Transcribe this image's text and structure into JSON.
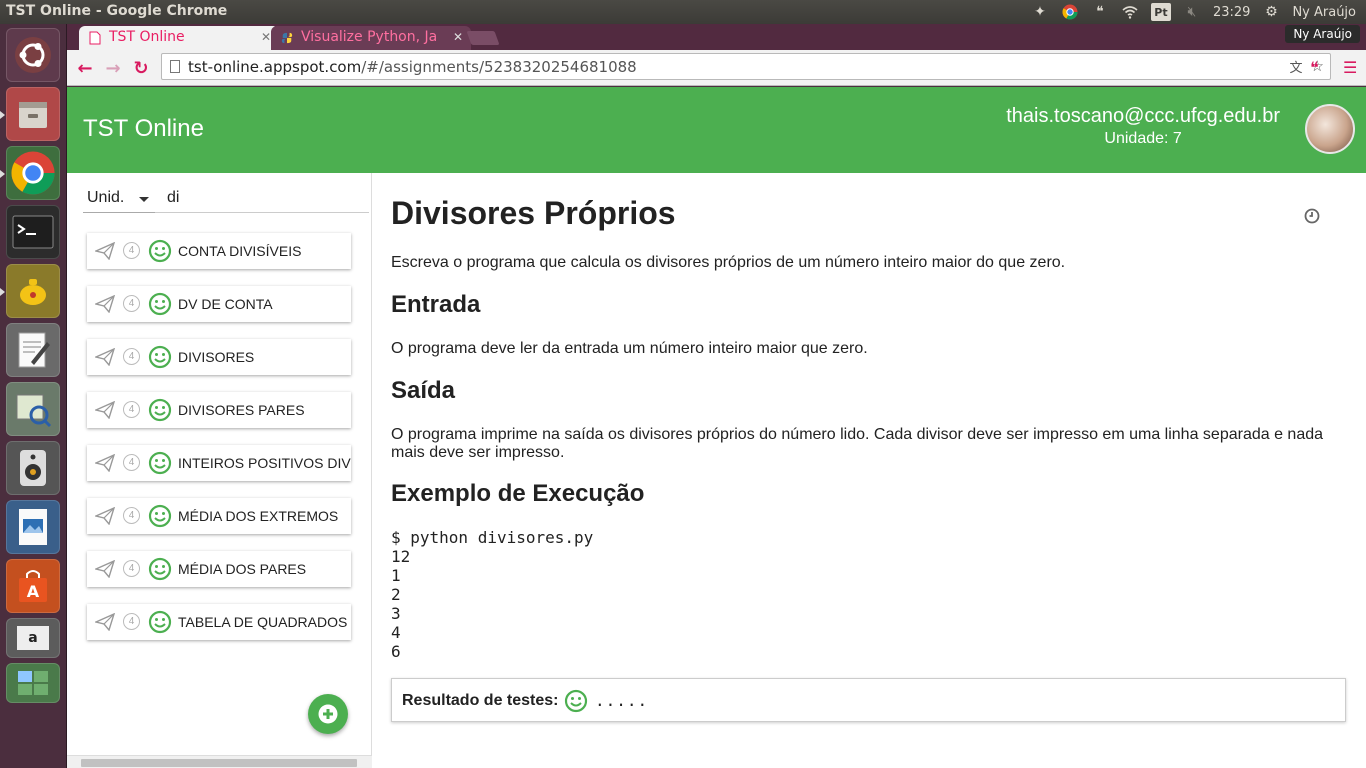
{
  "os": {
    "window_title": "TST Online - Google Chrome",
    "clock": "23:29",
    "user": "Ny Araújo",
    "tray_pt": "Pt"
  },
  "browser": {
    "tabs": [
      {
        "label": "TST Online",
        "active": true
      },
      {
        "label": "Visualize Python, Ja",
        "active": false
      }
    ],
    "profile": "Ny Araújo",
    "url_host": "tst-online.appspot.com",
    "url_path": "/#/assignments/5238320254681088"
  },
  "app": {
    "brand": "TST Online",
    "user_email": "thais.toscano@ccc.ufcg.edu.br",
    "user_unit": "Unidade: 7",
    "accent_color": "#4caf50"
  },
  "sidebar": {
    "unit_select": "Unid.",
    "filter_value": "di",
    "items": [
      {
        "title": "CONTA DIVISÍVEIS",
        "badge": "4"
      },
      {
        "title": "DV DE CONTA",
        "badge": "4"
      },
      {
        "title": "DIVISORES",
        "badge": "4"
      },
      {
        "title": "DIVISORES PARES",
        "badge": "4"
      },
      {
        "title": "INTEIROS POSITIVOS DIV",
        "badge": "4"
      },
      {
        "title": "MÉDIA DOS EXTREMOS",
        "badge": "4"
      },
      {
        "title": "MÉDIA DOS PARES",
        "badge": "4"
      },
      {
        "title": "TABELA DE QUADRADOS",
        "badge": "4"
      }
    ]
  },
  "assignment": {
    "title": "Divisores Próprios",
    "description": "Escreva o programa que calcula os divisores próprios de um número inteiro maior do que zero.",
    "input_heading": "Entrada",
    "input_text": "O programa deve ler da entrada um número inteiro maior que zero.",
    "output_heading": "Saída",
    "output_text": "O programa imprime na saída os divisores próprios do número lido. Cada divisor deve ser impresso em uma linha separada e nada mais deve ser impresso.",
    "example_heading": "Exemplo de Execução",
    "example_code": "$ python divisores.py\n12\n1\n2\n3\n4\n6",
    "result_label": "Resultado de testes:",
    "result_dots": "....."
  }
}
